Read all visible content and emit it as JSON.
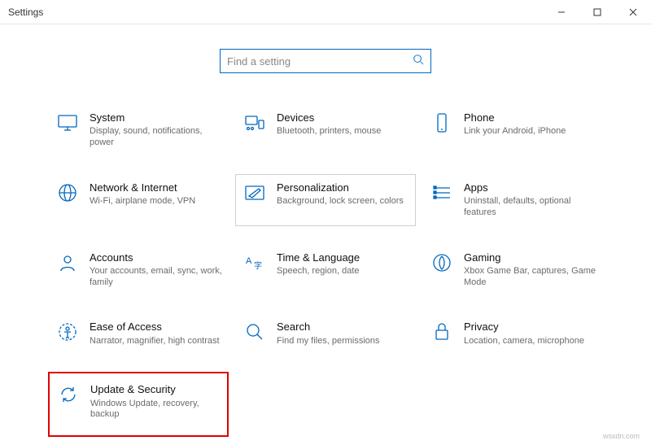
{
  "window": {
    "title": "Settings"
  },
  "search": {
    "placeholder": "Find a setting"
  },
  "tiles": {
    "system": {
      "title": "System",
      "desc": "Display, sound, notifications, power"
    },
    "devices": {
      "title": "Devices",
      "desc": "Bluetooth, printers, mouse"
    },
    "phone": {
      "title": "Phone",
      "desc": "Link your Android, iPhone"
    },
    "network": {
      "title": "Network & Internet",
      "desc": "Wi-Fi, airplane mode, VPN"
    },
    "personalization": {
      "title": "Personalization",
      "desc": "Background, lock screen, colors"
    },
    "apps": {
      "title": "Apps",
      "desc": "Uninstall, defaults, optional features"
    },
    "accounts": {
      "title": "Accounts",
      "desc": "Your accounts, email, sync, work, family"
    },
    "time": {
      "title": "Time & Language",
      "desc": "Speech, region, date"
    },
    "gaming": {
      "title": "Gaming",
      "desc": "Xbox Game Bar, captures, Game Mode"
    },
    "ease": {
      "title": "Ease of Access",
      "desc": "Narrator, magnifier, high contrast"
    },
    "searchTile": {
      "title": "Search",
      "desc": "Find my files, permissions"
    },
    "privacy": {
      "title": "Privacy",
      "desc": "Location, camera, microphone"
    },
    "update": {
      "title": "Update & Security",
      "desc": "Windows Update, recovery, backup"
    }
  },
  "watermark": "wsxdn.com"
}
